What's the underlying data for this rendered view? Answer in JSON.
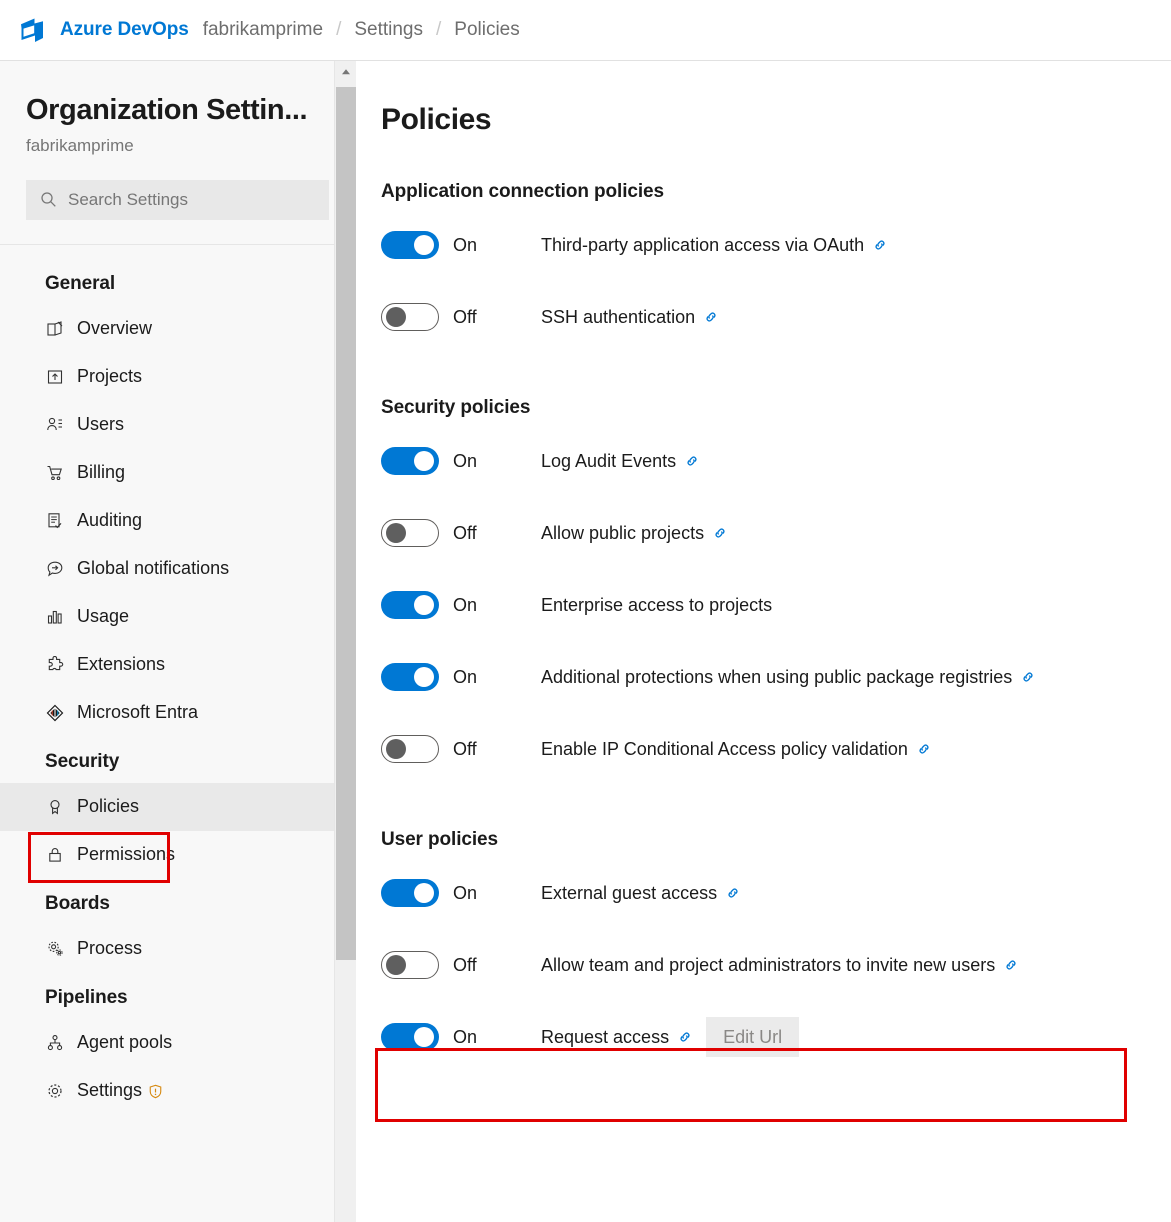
{
  "topbar": {
    "logo_icon": "azure-devops-logo",
    "brand": "Azure DevOps",
    "breadcrumb": [
      "fabrikamprime",
      "Settings",
      "Policies"
    ],
    "separator": "/"
  },
  "sidebar": {
    "title": "Organization Settin...",
    "subtitle": "fabrikamprime",
    "search": {
      "icon": "search-icon",
      "placeholder": "Search Settings"
    },
    "scrollbar": {
      "up_arrow_icon": "chevron-up-icon"
    },
    "groups": [
      {
        "label": "General",
        "items": [
          {
            "label": "Overview",
            "icon": "overview-icon",
            "active": false
          },
          {
            "label": "Projects",
            "icon": "projects-icon",
            "active": false
          },
          {
            "label": "Users",
            "icon": "users-icon",
            "active": false
          },
          {
            "label": "Billing",
            "icon": "billing-cart-icon",
            "active": false
          },
          {
            "label": "Auditing",
            "icon": "auditing-icon",
            "active": false
          },
          {
            "label": "Global notifications",
            "icon": "notification-bubble-icon",
            "active": false
          },
          {
            "label": "Usage",
            "icon": "usage-chart-icon",
            "active": false
          },
          {
            "label": "Extensions",
            "icon": "extensions-puzzle-icon",
            "active": false
          },
          {
            "label": "Microsoft Entra",
            "icon": "microsoft-entra-icon",
            "active": false
          }
        ]
      },
      {
        "label": "Security",
        "items": [
          {
            "label": "Policies",
            "icon": "policies-ribbon-icon",
            "active": true
          },
          {
            "label": "Permissions",
            "icon": "lock-icon",
            "active": false
          }
        ]
      },
      {
        "label": "Boards",
        "items": [
          {
            "label": "Process",
            "icon": "process-gear-icon",
            "active": false
          }
        ]
      },
      {
        "label": "Pipelines",
        "items": [
          {
            "label": "Agent pools",
            "icon": "agent-pools-icon",
            "active": false
          },
          {
            "label": "Settings",
            "icon": "settings-gear-icon",
            "badge": "shield-warning-icon",
            "active": false
          }
        ]
      }
    ]
  },
  "main": {
    "page_title": "Policies",
    "sections": [
      {
        "title": "Application connection policies",
        "policies": [
          {
            "state": "On",
            "enabled": true,
            "label": "Third-party application access via OAuth",
            "link": true
          },
          {
            "state": "Off",
            "enabled": false,
            "label": "SSH authentication",
            "link": true
          }
        ]
      },
      {
        "title": "Security policies",
        "policies": [
          {
            "state": "On",
            "enabled": true,
            "label": "Log Audit Events",
            "link": true
          },
          {
            "state": "Off",
            "enabled": false,
            "label": "Allow public projects",
            "link": true
          },
          {
            "state": "On",
            "enabled": true,
            "label": "Enterprise access to projects",
            "link": false
          },
          {
            "state": "On",
            "enabled": true,
            "label": "Additional protections when using public package registries",
            "link": true
          },
          {
            "state": "Off",
            "enabled": false,
            "label": "Enable IP Conditional Access policy validation",
            "link": true
          }
        ]
      },
      {
        "title": "User policies",
        "policies": [
          {
            "state": "On",
            "enabled": true,
            "label": "External guest access",
            "link": true
          },
          {
            "state": "Off",
            "enabled": false,
            "label": "Allow team and project administrators to invite new users",
            "link": true,
            "highlighted": true
          },
          {
            "state": "On",
            "enabled": true,
            "label": "Request access",
            "link": true,
            "button": "Edit Url"
          }
        ]
      }
    ]
  },
  "annotations": {
    "highlight_color": "#e00000",
    "sidebar_target": "Policies",
    "content_target": "Allow team and project administrators to invite new users"
  },
  "colors": {
    "brand_blue": "#0078d4",
    "toggle_on": "#0078d4",
    "active_row": "#e9e9e9",
    "sidebar_bg": "#f8f8f8",
    "annotation_red": "#e00000"
  }
}
